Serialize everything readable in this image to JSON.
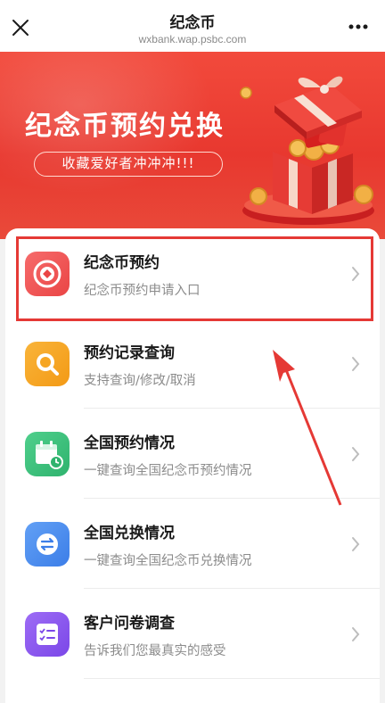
{
  "navbar": {
    "title": "纪念币",
    "url": "wxbank.wap.psbc.com"
  },
  "banner": {
    "title": "纪念币预约兑换",
    "subtitle": "收藏爱好者冲冲冲!!!"
  },
  "menu": [
    {
      "title": "纪念币预约",
      "desc": "纪念币预约申请入口",
      "icon": "coin-target-icon",
      "color": "#f15a5a"
    },
    {
      "title": "预约记录查询",
      "desc": "支持查询/修改/取消",
      "icon": "search-icon",
      "color": "#f7a623"
    },
    {
      "title": "全国预约情况",
      "desc": "一键查询全国纪念币预约情况",
      "icon": "calendar-clock-icon",
      "color": "#3fbf7f"
    },
    {
      "title": "全国兑换情况",
      "desc": "一键查询全国纪念币兑换情况",
      "icon": "exchange-icon",
      "color": "#4f8ff0"
    },
    {
      "title": "客户问卷调查",
      "desc": "告诉我们您最真实的感受",
      "icon": "checklist-icon",
      "color": "#8c5cf0"
    }
  ],
  "colors": {
    "accent": "#e8382f",
    "highlight": "#e53935"
  }
}
